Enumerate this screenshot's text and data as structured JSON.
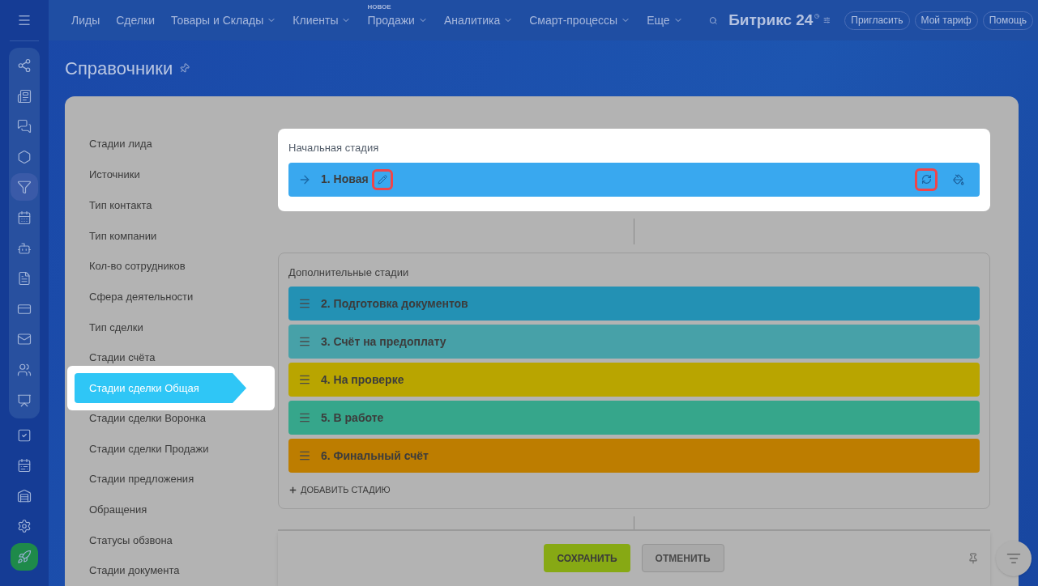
{
  "top_nav": {
    "items": [
      {
        "label": "Лиды",
        "dropdown": false
      },
      {
        "label": "Сделки",
        "dropdown": false
      },
      {
        "label": "Товары и Склады",
        "dropdown": true
      },
      {
        "label": "Клиенты",
        "dropdown": true
      },
      {
        "label": "Продажи",
        "dropdown": true,
        "badge": "НОВОЕ"
      },
      {
        "label": "Аналитика",
        "dropdown": true
      },
      {
        "label": "Смарт-процессы",
        "dropdown": true
      },
      {
        "label": "Еще",
        "dropdown": true
      }
    ],
    "logo": "Битрикс 24",
    "buttons": [
      "Пригласить",
      "Мой тариф",
      "Помощь"
    ]
  },
  "side_icons": [
    {
      "kind": "circles",
      "selected": false
    },
    {
      "kind": "news",
      "selected": false
    },
    {
      "kind": "chat",
      "selected": false
    },
    {
      "kind": "hexagon",
      "selected": false
    },
    {
      "kind": "funnel",
      "selected": true
    },
    {
      "kind": "calendar",
      "selected": false
    },
    {
      "kind": "robot",
      "selected": false
    },
    {
      "kind": "document",
      "selected": false
    },
    {
      "kind": "card",
      "selected": false
    },
    {
      "kind": "mail",
      "selected": false
    },
    {
      "kind": "people",
      "selected": false
    },
    {
      "kind": "board",
      "selected": false
    },
    {
      "kind": "check",
      "selected": false
    },
    {
      "kind": "schedule",
      "selected": false
    },
    {
      "kind": "garage",
      "selected": false
    },
    {
      "kind": "settings",
      "selected": false
    },
    {
      "kind": "rocket",
      "selected": false
    }
  ],
  "page_title": "Справочники",
  "directories": [
    {
      "label": "Стадии лида",
      "selected": false
    },
    {
      "label": "Источники",
      "selected": false
    },
    {
      "label": "Тип контакта",
      "selected": false
    },
    {
      "label": "Тип компании",
      "selected": false
    },
    {
      "label": "Кол-во сотрудников",
      "selected": false
    },
    {
      "label": "Сфера деятельности",
      "selected": false
    },
    {
      "label": "Тип сделки",
      "selected": false
    },
    {
      "label": "Стадии счёта",
      "selected": false
    },
    {
      "label": "Стадии сделки Общая",
      "selected": true
    },
    {
      "label": "Стадии сделки Воронка",
      "selected": false
    },
    {
      "label": "Стадии сделки Продажи",
      "selected": false
    },
    {
      "label": "Стадии предложения",
      "selected": false
    },
    {
      "label": "Обращения",
      "selected": false
    },
    {
      "label": "Статусы обзвона",
      "selected": false
    },
    {
      "label": "Стадии документа",
      "selected": false
    }
  ],
  "initial_stage": {
    "title": "Начальная стадия",
    "stage": {
      "name": "1. Новая",
      "color": "#39a8ef",
      "edit_highlighted": true,
      "reset_highlighted": true
    }
  },
  "additional_stages": {
    "title": "Дополнительные стадии",
    "stages": [
      {
        "name": "2. Подготовка документов",
        "color": "#2391b4"
      },
      {
        "name": "3. Счёт на предоплату",
        "color": "#47a1a8"
      },
      {
        "name": "4. На проверке",
        "color": "#b9a500"
      },
      {
        "name": "5. В работе",
        "color": "#36a68b"
      },
      {
        "name": "6. Финальный счёт",
        "color": "#bd7d00"
      }
    ],
    "add_label": "ДОБАВИТЬ СТАДИЮ"
  },
  "footer": {
    "save": "СОХРАНИТЬ",
    "cancel": "ОТМЕНИТЬ"
  }
}
